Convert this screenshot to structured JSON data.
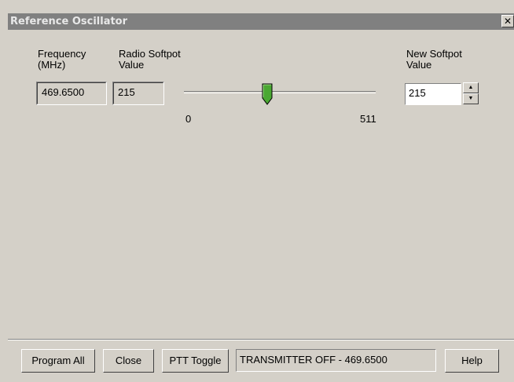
{
  "window": {
    "title": "Reference Oscillator",
    "close_glyph": "✕"
  },
  "frequency": {
    "label_line1": "Frequency",
    "label_line2": "(MHz)",
    "value": "469.6500"
  },
  "radio_softpot": {
    "label_line1": "Radio Softpot",
    "label_line2": "Value",
    "value": "215"
  },
  "slider": {
    "min_label": "0",
    "max_label": "511",
    "min": 0,
    "max": 511,
    "value": 215,
    "thumb_color": "#4aa832"
  },
  "new_softpot": {
    "label_line1": "New Softpot",
    "label_line2": "Value",
    "value": "215",
    "up_glyph": "▲",
    "down_glyph": "▼"
  },
  "buttons": {
    "program_all": "Program All",
    "close": "Close",
    "ptt_toggle": "PTT Toggle",
    "help": "Help"
  },
  "status": {
    "text": "TRANSMITTER OFF - 469.6500"
  }
}
